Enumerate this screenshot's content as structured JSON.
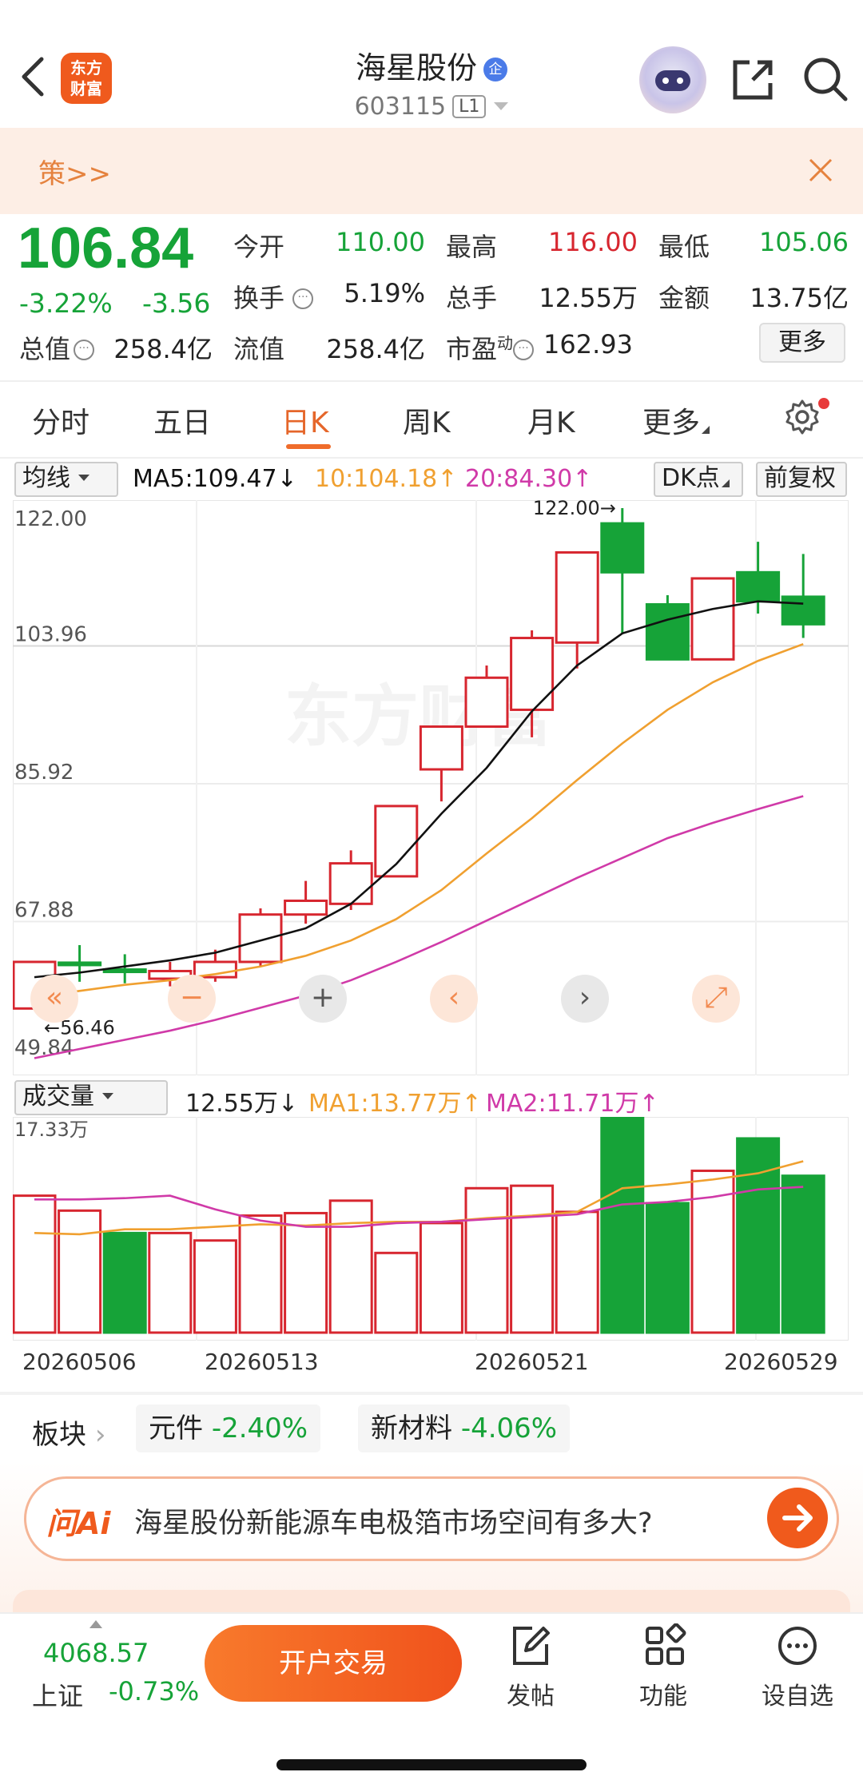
{
  "header": {
    "logo_line1": "东方",
    "logo_line2": "财富",
    "title": "海星股份",
    "title_badge": "企",
    "code": "603115",
    "level_badge": "L1"
  },
  "banner": {
    "text": "策>>"
  },
  "quote": {
    "price": "106.84",
    "change_pct": "-3.22%",
    "change_amt": "-3.56",
    "open_label": "今开",
    "open": "110.00",
    "high_label": "最高",
    "high": "116.00",
    "low_label": "最低",
    "low": "105.06",
    "turnover_label": "换手",
    "turnover": "5.19%",
    "volume_label": "总手",
    "volume": "12.55万",
    "amount_label": "金额",
    "amount": "13.75亿",
    "mktcap_label": "总值",
    "mktcap": "258.4亿",
    "float_label": "流值",
    "float": "258.4亿",
    "pe_label": "市盈",
    "pe_sup": "动",
    "pe": "162.93",
    "more_label": "更多"
  },
  "tabs": [
    "分时",
    "五日",
    "日K",
    "周K",
    "月K",
    "更多"
  ],
  "active_tab": "日K",
  "ma_bar": {
    "selector": "均线",
    "ma5": "MA5:109.47",
    "ma10": "10:104.18",
    "ma20": "20:84.30",
    "dk_label": "DK点",
    "adjust_label": "前复权",
    "arrow_down": "↓",
    "arrow_up": "↑"
  },
  "vol_bar": {
    "selector": "成交量",
    "vol": "12.55万",
    "ma1": "MA1:13.77万",
    "ma2": "MA2:11.71万",
    "arrow_down": "↓",
    "arrow_up": "↑"
  },
  "colors": {
    "up": "#d7262f",
    "down": "#16a338",
    "ma5": "#111111",
    "ma10": "#f0a030",
    "ma20": "#d03aa8",
    "accent": "#ef6c2b"
  },
  "chart_data": {
    "type": "candlestick",
    "watermark": "东方财富",
    "y_ticks": [
      "122.00",
      "103.96",
      "85.92",
      "67.88",
      "49.84"
    ],
    "ylim": [
      49.84,
      122.0
    ],
    "max_label": "122.00→",
    "min_label": "←56.46",
    "candles": [
      {
        "open": 56.5,
        "close": 62.6,
        "high": 62.6,
        "low": 56.5,
        "dir": "up"
      },
      {
        "open": 62.5,
        "close": 62.5,
        "high": 64.8,
        "low": 60.0,
        "dir": "down"
      },
      {
        "open": 61.6,
        "close": 61.6,
        "high": 63.6,
        "low": 59.8,
        "dir": "down"
      },
      {
        "open": 60.4,
        "close": 61.4,
        "high": 62.6,
        "low": 59.4,
        "dir": "up"
      },
      {
        "open": 60.6,
        "close": 62.6,
        "high": 64.2,
        "low": 60.0,
        "dir": "up"
      },
      {
        "open": 62.6,
        "close": 68.8,
        "high": 69.6,
        "low": 62.0,
        "dir": "up"
      },
      {
        "open": 68.8,
        "close": 70.6,
        "high": 73.2,
        "low": 67.6,
        "dir": "up"
      },
      {
        "open": 70.2,
        "close": 75.5,
        "high": 77.2,
        "low": 69.4,
        "dir": "up"
      },
      {
        "open": 73.8,
        "close": 83.0,
        "high": 83.0,
        "low": 73.8,
        "dir": "up"
      },
      {
        "open": 87.8,
        "close": 93.4,
        "high": 93.4,
        "low": 83.6,
        "dir": "up"
      },
      {
        "open": 93.4,
        "close": 99.8,
        "high": 101.4,
        "low": 93.4,
        "dir": "up"
      },
      {
        "open": 95.6,
        "close": 105.0,
        "high": 106.0,
        "low": 92.0,
        "dir": "up"
      },
      {
        "open": 104.4,
        "close": 116.2,
        "high": 116.2,
        "low": 101.0,
        "dir": "up"
      },
      {
        "open": 120.0,
        "close": 113.6,
        "high": 122.0,
        "low": 105.6,
        "dir": "down"
      },
      {
        "open": 109.4,
        "close": 102.2,
        "high": 110.6,
        "low": 102.2,
        "dir": "down"
      },
      {
        "open": 102.2,
        "close": 112.8,
        "high": 112.8,
        "low": 102.2,
        "dir": "up"
      },
      {
        "open": 113.6,
        "close": 109.8,
        "high": 117.6,
        "low": 108.2,
        "dir": "down"
      },
      {
        "open": 110.4,
        "close": 106.8,
        "high": 116.0,
        "low": 105.0,
        "dir": "down"
      }
    ],
    "ma5": [
      60.6,
      61.2,
      62.0,
      62.8,
      63.8,
      65.4,
      67.0,
      70.2,
      75.4,
      82.0,
      88.0,
      95.4,
      101.4,
      105.6,
      107.4,
      108.8,
      109.8,
      109.5
    ],
    "ma10": [
      58.0,
      58.8,
      59.6,
      60.2,
      61.0,
      62.0,
      63.4,
      65.4,
      68.2,
      72.0,
      76.8,
      81.4,
      86.4,
      91.2,
      95.6,
      99.2,
      102.0,
      104.2
    ],
    "ma20": [
      50.0,
      51.2,
      52.4,
      53.6,
      55.0,
      56.6,
      58.2,
      60.2,
      62.6,
      65.2,
      68.0,
      70.8,
      73.6,
      76.2,
      78.8,
      80.8,
      82.6,
      84.3
    ],
    "volume": {
      "y_top_label": "17.33万",
      "ymax": 17.33,
      "values": [
        11.0,
        9.8,
        8.0,
        8.0,
        7.4,
        9.4,
        9.6,
        10.6,
        6.4,
        8.8,
        11.6,
        11.8,
        9.7,
        17.3,
        10.4,
        13.0,
        15.6,
        12.6
      ],
      "dirs": [
        "up",
        "up",
        "down",
        "up",
        "up",
        "up",
        "up",
        "up",
        "up",
        "up",
        "up",
        "up",
        "up",
        "down",
        "down",
        "up",
        "down",
        "down"
      ],
      "ma1": [
        8.0,
        7.9,
        8.3,
        8.3,
        8.5,
        8.7,
        8.6,
        8.8,
        8.9,
        8.9,
        9.2,
        9.4,
        9.7,
        11.6,
        11.9,
        12.3,
        12.8,
        13.77
      ],
      "ma2": [
        10.7,
        10.7,
        10.8,
        11.0,
        9.9,
        9.0,
        8.5,
        8.5,
        8.8,
        8.9,
        9.1,
        9.3,
        9.5,
        10.3,
        10.5,
        10.9,
        11.5,
        11.71
      ]
    },
    "x_ticks": [
      "20260506",
      "20260513",
      "20260521",
      "20260529"
    ]
  },
  "sectors": {
    "label": "板块",
    "items": [
      {
        "name": "元件",
        "change": "-2.40%"
      },
      {
        "name": "新材料",
        "change": "-4.06%"
      }
    ]
  },
  "ai": {
    "logo": "问Ai",
    "question": "海星股份新能源车电极箔市场空间有多大?"
  },
  "bottom": {
    "index_value": "4068.57",
    "index_name": "上证",
    "index_change": "-0.73%",
    "trade_label": "开户交易",
    "post_label": "发帖",
    "func_label": "功能",
    "watch_label": "设自选"
  }
}
